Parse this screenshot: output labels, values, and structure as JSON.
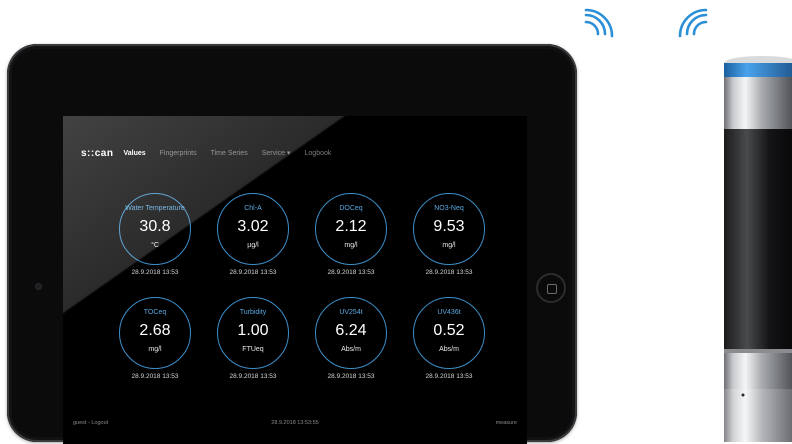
{
  "app": {
    "brand": "s::can",
    "nav": [
      {
        "label": "Values",
        "active": true
      },
      {
        "label": "Fingerprints",
        "active": false
      },
      {
        "label": "Time Series",
        "active": false
      },
      {
        "label": "Service ▾",
        "active": false
      },
      {
        "label": "Logbook",
        "active": false
      }
    ]
  },
  "readings": [
    {
      "name": "Water Temperature",
      "value": "30.8",
      "unit": "°C",
      "timestamp": "28.9.2018 13:53"
    },
    {
      "name": "Chl-A",
      "value": "3.02",
      "unit": "µg/l",
      "timestamp": "28.9.2018 13:53"
    },
    {
      "name": "DOCeq",
      "value": "2.12",
      "unit": "mg/l",
      "timestamp": "28.9.2018 13:53"
    },
    {
      "name": "NO3-Neq",
      "value": "9.53",
      "unit": "mg/l",
      "timestamp": "28.9.2018 13:53"
    },
    {
      "name": "TOCeq",
      "value": "2.68",
      "unit": "mg/l",
      "timestamp": "28.9.2018 13:53"
    },
    {
      "name": "Turbidity",
      "value": "1.00",
      "unit": "FTUeq",
      "timestamp": "28.9.2018 13:53"
    },
    {
      "name": "UV254t",
      "value": "6.24",
      "unit": "Abs/m",
      "timestamp": "28.9.2018 13:53"
    },
    {
      "name": "UV436t",
      "value": "0.52",
      "unit": "Abs/m",
      "timestamp": "28.9.2018 13:53"
    }
  ],
  "footer": {
    "user": "guest - Logout",
    "datetime": "28.9.2018 13:53:55",
    "mode": "measure"
  },
  "colors": {
    "gauge_ring": "#3d8ec7",
    "gauge_label": "#58a8e0",
    "probe_band": "#2f86d6"
  },
  "icons": [
    "wifi-signal-icon",
    "home-button-icon"
  ]
}
